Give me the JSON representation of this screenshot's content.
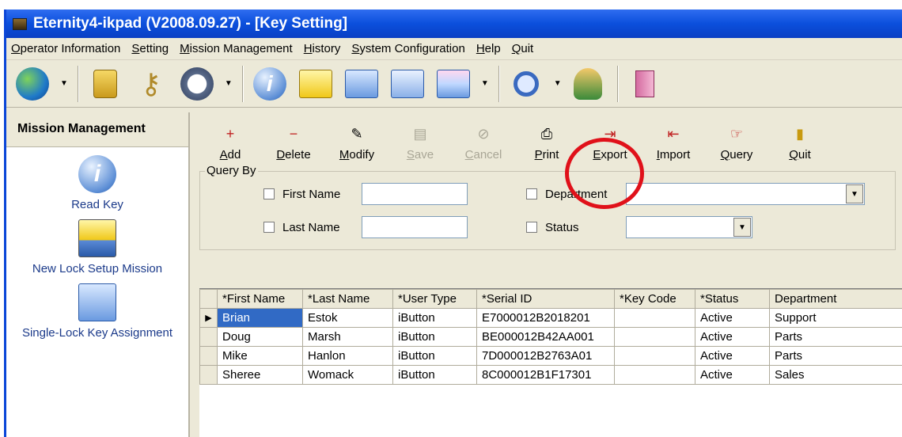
{
  "window": {
    "title": "Eternity4-ikpad   (V2008.09.27) - [Key Setting]"
  },
  "menu": [
    "Operator Information",
    "Setting",
    "Mission Management",
    "History",
    "System Configuration",
    "Help",
    "Quit"
  ],
  "sidebar": {
    "header": "Mission Management",
    "items": [
      {
        "label": "Read Key",
        "icon": "info-icon"
      },
      {
        "label": "New Lock Setup Mission",
        "icon": "folder-red-arrow-icon"
      },
      {
        "label": "Single-Lock Key Assignment",
        "icon": "folder-yellow-arrow-icon"
      }
    ]
  },
  "actions": [
    {
      "label": "Add",
      "icon": "+",
      "enabled": true
    },
    {
      "label": "Delete",
      "icon": "−",
      "enabled": true
    },
    {
      "label": "Modify",
      "icon": "✎",
      "enabled": true
    },
    {
      "label": "Save",
      "icon": "▤",
      "enabled": false
    },
    {
      "label": "Cancel",
      "icon": "⊘",
      "enabled": false
    },
    {
      "label": "Print",
      "icon": "⎙",
      "enabled": true
    },
    {
      "label": "Export",
      "icon": "⇥",
      "enabled": true
    },
    {
      "label": "Import",
      "icon": "⇤",
      "enabled": true
    },
    {
      "label": "Query",
      "icon": "☞",
      "enabled": true
    },
    {
      "label": "Quit",
      "icon": "▮",
      "enabled": true
    }
  ],
  "query": {
    "legend": "Query By",
    "first_name": "First Name",
    "last_name": "Last Name",
    "department": "Department",
    "status": "Status"
  },
  "table": {
    "columns": [
      "*First Name",
      "*Last Name",
      "*User Type",
      "*Serial ID",
      "*Key Code",
      "*Status",
      "Department"
    ],
    "rows": [
      [
        "Brian",
        "Estok",
        "iButton",
        "E7000012B2018201",
        "",
        "Active",
        "Support"
      ],
      [
        "Doug",
        "Marsh",
        "iButton",
        "BE000012B42AA001",
        "",
        "Active",
        "Parts"
      ],
      [
        "Mike",
        "Hanlon",
        "iButton",
        "7D000012B2763A01",
        "",
        "Active",
        "Parts"
      ],
      [
        "Sheree",
        "Womack",
        "iButton",
        "8C000012B1F17301",
        "",
        "Active",
        "Sales"
      ]
    ]
  }
}
